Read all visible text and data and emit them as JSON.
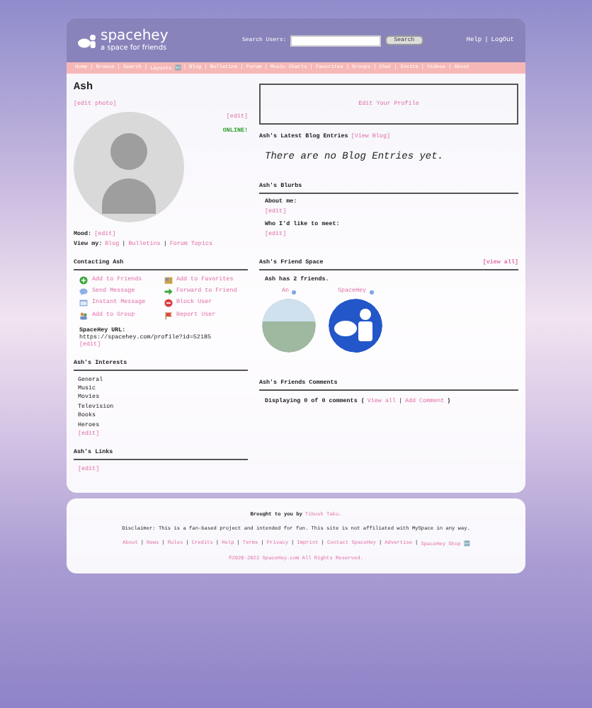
{
  "header": {
    "logo": "spacehey",
    "tagline": "a space for friends",
    "search_label": "Search Users:",
    "search_button": "Search",
    "links": [
      "Help",
      "LogOut"
    ],
    "separator": "|"
  },
  "nav": {
    "separator": "|",
    "items": [
      "Home",
      "Browse",
      "Search",
      "Layouts 🆕",
      "Blog",
      "Bulletins",
      "Forum",
      "Music Charts",
      "Favorites",
      "Groups",
      "Chat",
      "Invite",
      "Videos",
      "About"
    ]
  },
  "profile": {
    "name": "Ash",
    "edit_photo": "[edit photo]",
    "photo_edit": "[edit]",
    "status": "ONLINE!",
    "mood_label": "Mood:",
    "mood_edit": "[edit]",
    "view_label": "View my:",
    "view_links": [
      "Blog",
      "Bulletins",
      "Forum Topics"
    ],
    "view_separator": "|"
  },
  "contact": {
    "title": "Contacting Ash",
    "actions": [
      {
        "kind": "add-friend",
        "label": "Add to Friends"
      },
      {
        "kind": "favorite",
        "label": "Add to Favorites"
      },
      {
        "kind": "message",
        "label": "Send Message"
      },
      {
        "kind": "forward",
        "label": "Forward to Friend"
      },
      {
        "kind": "im",
        "label": "Instant Message"
      },
      {
        "kind": "block",
        "label": "Block User"
      },
      {
        "kind": "group",
        "label": "Add to Group"
      },
      {
        "kind": "report",
        "label": "Report User"
      }
    ],
    "url_label": "SpaceHey URL:",
    "url": "https://spacehey.com/profile?id=52185",
    "url_edit": "[edit]"
  },
  "interests": {
    "title": "Ash's Interests",
    "items": [
      "General",
      "Music",
      "Movies",
      "Television",
      "Books",
      "Heroes"
    ],
    "edit": "[edit]"
  },
  "links": {
    "title": "Ash's Links",
    "edit": "[edit]"
  },
  "edit_profile": "Edit Your Profile",
  "blog": {
    "title": "Ash's Latest Blog Entries",
    "link": "[View Blog]",
    "empty": "There are no Blog Entries yet."
  },
  "blurbs": {
    "title": "Ash's Blurbs",
    "items": [
      {
        "label": "About me:",
        "edit": "[edit]"
      },
      {
        "label": "Who I'd like to meet:",
        "edit": "[edit]"
      }
    ]
  },
  "friend_space": {
    "title": "Ash's Friend Space",
    "view_all": "[view all]",
    "count": "Ash has 2 friends.",
    "friends": [
      {
        "name": "An",
        "kind": "photo"
      },
      {
        "name": "SpaceHey",
        "kind": "logo"
      }
    ]
  },
  "comments": {
    "title": "Ash's Friends Comments",
    "prefix": "Displaying 0 of 0 comments (",
    "links": [
      "View all",
      "Add Comment"
    ],
    "separator": "|",
    "suffix": ")"
  },
  "footer": {
    "credit": "Brought to you by",
    "credit_link": "Tibush Tabu.",
    "disclaimer": "Disclaimer: This is a fan-based project and intended for fun. This site is not affiliated with MySpace in any way.",
    "separator": "|",
    "links": [
      "About",
      "News",
      "Rules",
      "Credits",
      "Help",
      "Terms",
      "Privacy",
      "Imprint",
      "Contact SpaceHey",
      "Advertise",
      "SpaceHey Shop 🆕"
    ],
    "copyright": "©2020-2022 SpaceHey.com All Rights Reserved."
  }
}
